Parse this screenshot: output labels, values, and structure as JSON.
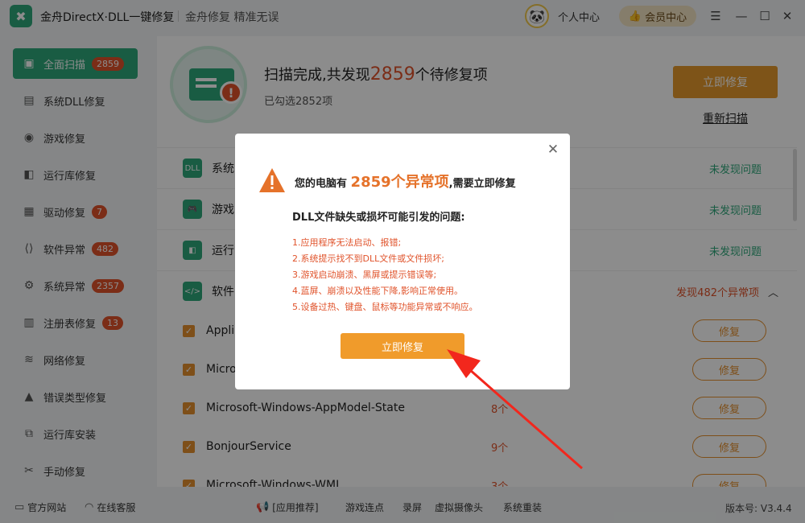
{
  "app": {
    "title": "金舟DirectX·DLL一键修复",
    "slogan": "金舟修复 精准无误",
    "personal_center": "个人中心",
    "vip_center": "会员中心"
  },
  "sidebar": {
    "items": [
      {
        "label": "全面扫描",
        "badge": "2859",
        "icon": "scan-icon"
      },
      {
        "label": "系统DLL修复",
        "badge": "",
        "icon": "dll-icon"
      },
      {
        "label": "游戏修复",
        "badge": "",
        "icon": "gamepad-icon"
      },
      {
        "label": "运行库修复",
        "badge": "",
        "icon": "runtime-icon"
      },
      {
        "label": "驱动修复",
        "badge": "7",
        "icon": "driver-icon"
      },
      {
        "label": "软件异常",
        "badge": "482",
        "icon": "code-icon"
      },
      {
        "label": "系统异常",
        "badge": "2357",
        "icon": "gear-icon"
      },
      {
        "label": "注册表修复",
        "badge": "13",
        "icon": "registry-icon"
      },
      {
        "label": "网络修复",
        "badge": "",
        "icon": "wifi-icon"
      },
      {
        "label": "错误类型修复",
        "badge": "",
        "icon": "warning-icon"
      },
      {
        "label": "运行库安装",
        "badge": "",
        "icon": "install-icon"
      },
      {
        "label": "手动修复",
        "badge": "",
        "icon": "wrench-icon"
      }
    ]
  },
  "scan": {
    "headline_prefix": "扫描完成,共发现",
    "count": "2859",
    "headline_suffix": "个待修复项",
    "selected": "已勾选2852项",
    "fix_now": "立即修复",
    "rescan": "重新扫描"
  },
  "categories": [
    {
      "label": "系统",
      "status": "未发现问题",
      "icon_text": "DLL"
    },
    {
      "label": "游戏",
      "status": "未发现问题",
      "icon_text": "🎮"
    },
    {
      "label": "运行",
      "status": "未发现问题",
      "icon_text": "◧"
    },
    {
      "label": "软件",
      "status": "发现482个异常项",
      "icon_text": "</>"
    }
  ],
  "items": [
    {
      "name": "Appli",
      "count": "",
      "repair": "修复"
    },
    {
      "name": "Micro",
      "count": "",
      "repair": "修复"
    },
    {
      "name": "Microsoft-Windows-AppModel-State",
      "count": "8个",
      "repair": "修复"
    },
    {
      "name": "BonjourService",
      "count": "9个",
      "repair": "修复"
    },
    {
      "name": "Microsoft-Windows-WMI",
      "count": "3个",
      "repair": "修复"
    }
  ],
  "modal": {
    "head_prefix": "您的电脑有",
    "head_count": "2859个异常项",
    "head_suffix": ",需要立即修复",
    "subtitle": "DLL文件缺失或损坏可能引发的问题:",
    "reasons": [
      "1.应用程序无法启动、报错;",
      "2.系统提示找不到DLL文件或文件损坏;",
      "3.游戏启动崩溃、黑屏或提示错误等;",
      "4.蓝屏、崩溃以及性能下降,影响正常使用。",
      "5.设备过热、键盘、鼠标等功能异常或不响应。"
    ],
    "fix_button": "立即修复"
  },
  "footer": {
    "official_site": "官方网站",
    "online_service": "在线客服",
    "recommend": "[应用推荐]",
    "links": [
      "游戏连点",
      "录屏",
      "虚拟摄像头",
      "系统重装"
    ],
    "version": "版本号: V3.4.4"
  },
  "colors": {
    "brand": "#2fa87b",
    "accent": "#e59a2d",
    "danger": "#e0532b"
  }
}
